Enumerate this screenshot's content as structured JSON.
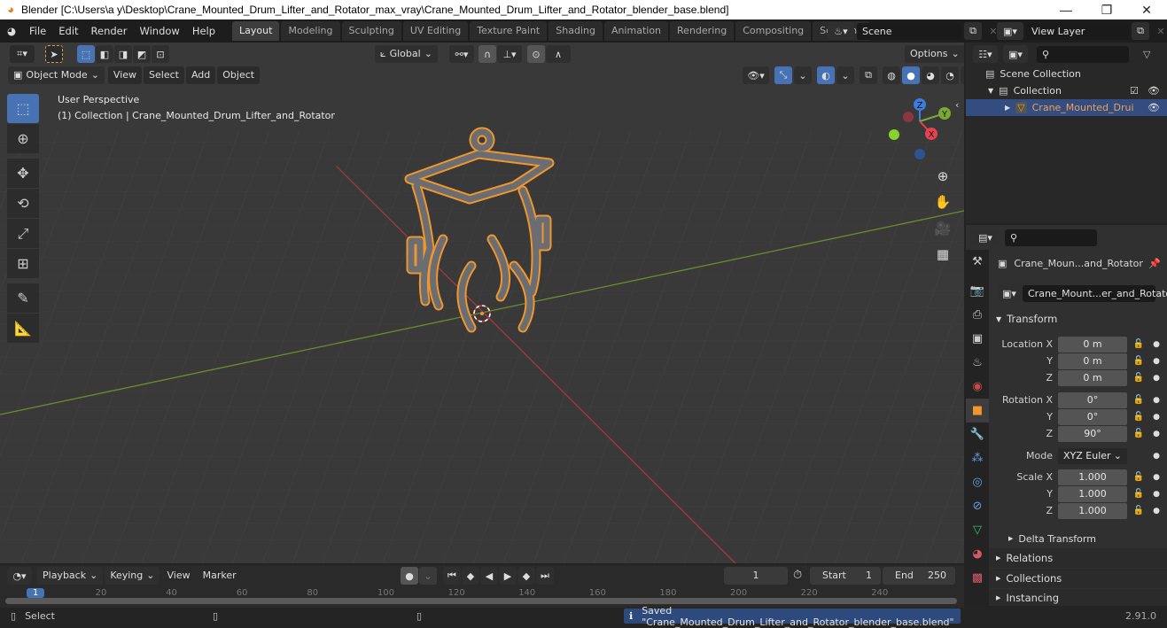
{
  "window": {
    "title": "Blender [C:\\Users\\a y\\Desktop\\Crane_Mounted_Drum_Lifter_and_Rotator_max_vray\\Crane_Mounted_Drum_Lifter_and_Rotator_blender_base.blend]",
    "controls": [
      "minimize",
      "restore",
      "close"
    ]
  },
  "menubar": {
    "items": [
      "File",
      "Edit",
      "Render",
      "Window",
      "Help"
    ]
  },
  "workspaces": {
    "tabs": [
      "Layout",
      "Modeling",
      "Sculpting",
      "UV Editing",
      "Texture Paint",
      "Shading",
      "Animation",
      "Rendering",
      "Compositing",
      "Scripting"
    ],
    "active": "Layout",
    "add_label": "+"
  },
  "scene": {
    "name": "Scene"
  },
  "view_layer": {
    "name": "View Layer"
  },
  "viewport_header": {
    "transform_orientation": "Global",
    "options_label": "Options",
    "mode": "Object Mode",
    "menus": [
      "View",
      "Select",
      "Add",
      "Object"
    ]
  },
  "viewport": {
    "perspective_label": "User Perspective",
    "context_label": "(1) Collection | Crane_Mounted_Drum_Lifter_and_Rotator",
    "gizmo_axes": [
      "X",
      "Y",
      "Z"
    ],
    "colors": {
      "x_axis": "#e8414f",
      "y_axis": "#7ca934",
      "z_axis": "#3a7ee0",
      "selection_outline": "#f0962e"
    }
  },
  "tools": [
    "select-box",
    "cursor",
    "move",
    "rotate",
    "scale",
    "transform",
    "annotate",
    "measure"
  ],
  "outliner": {
    "search_placeholder": "",
    "items": [
      {
        "label": "Scene Collection",
        "level": 0
      },
      {
        "label": "Collection",
        "level": 1,
        "checked": true,
        "visible": true
      },
      {
        "label": "Crane_Mounted_Drui",
        "level": 2,
        "selected": true,
        "visible": true
      }
    ]
  },
  "properties": {
    "search_placeholder": "",
    "object_name": "Crane_Moun...and_Rotator",
    "data_name": "Crane_Mount...er_and_Rotator",
    "transform_label": "Transform",
    "location": {
      "label": "Location",
      "x": "0 m",
      "y": "0 m",
      "z": "0 m"
    },
    "rotation": {
      "label": "Rotation",
      "x": "0°",
      "y": "0°",
      "z": "90°"
    },
    "mode": {
      "label": "Mode",
      "value": "XYZ Euler"
    },
    "scale": {
      "label": "Scale",
      "x": "1.000",
      "y": "1.000",
      "z": "1.000"
    },
    "axis_labels": {
      "x": "X",
      "y": "Y",
      "z": "Z"
    },
    "subsections": [
      "Delta Transform"
    ],
    "panels": [
      "Relations",
      "Collections",
      "Instancing"
    ]
  },
  "timeline": {
    "menus": [
      "Playback",
      "Keying",
      "View",
      "Marker"
    ],
    "current_frame": "1",
    "start_label": "Start",
    "start": "1",
    "end_label": "End",
    "end": "250",
    "ruler_ticks": [
      "1",
      "20",
      "40",
      "60",
      "80",
      "100",
      "120",
      "140",
      "160",
      "180",
      "200",
      "220",
      "240"
    ]
  },
  "statusbar": {
    "select_label": "Select",
    "message": "Saved \"Crane_Mounted_Drum_Lifter_and_Rotator_blender_base.blend\"",
    "version": "2.91.0"
  }
}
